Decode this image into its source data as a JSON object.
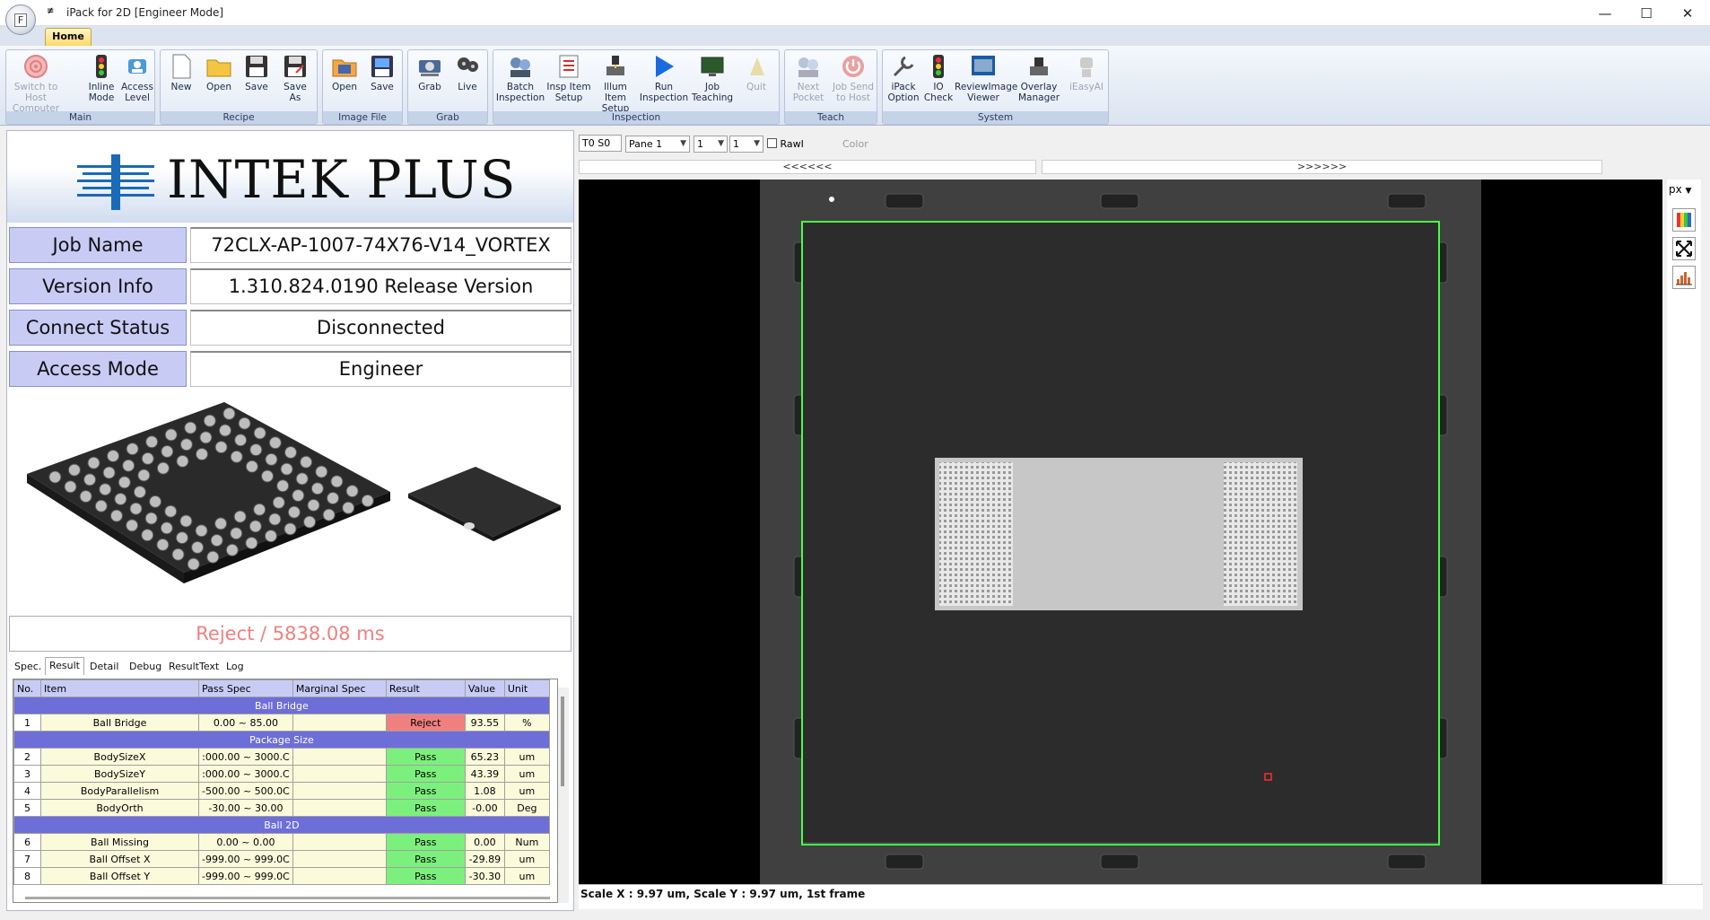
{
  "window": {
    "title": "iPack for 2D [Engineer Mode]",
    "orb_label": "F",
    "qat_glyph": "≢"
  },
  "ribbon": {
    "tab_home": "Home",
    "groups": [
      {
        "label": "Main",
        "buttons": [
          "Switch to Host Computer",
          "Inline Mode",
          "Access Level"
        ]
      },
      {
        "label": "Recipe",
        "buttons": [
          "New",
          "Open",
          "Save",
          "Save As"
        ]
      },
      {
        "label": "Image File",
        "buttons": [
          "Open",
          "Save"
        ]
      },
      {
        "label": "Grab",
        "buttons": [
          "Grab",
          "Live"
        ]
      },
      {
        "label": "Inspection",
        "buttons": [
          "Batch Inspection",
          "Insp Item Setup",
          "Illum Item Setup",
          "Run Inspection",
          "Job Teaching",
          "Quit"
        ]
      },
      {
        "label": "Teach",
        "buttons": [
          "Next Pocket",
          "Job Send to Host"
        ]
      },
      {
        "label": "System",
        "buttons": [
          "iPack Option",
          "IO Check",
          "ReviewImage Viewer",
          "Overlay Manager",
          "iEasyAI"
        ]
      }
    ]
  },
  "logo": {
    "text": "INTEK PLUS"
  },
  "info": {
    "job_name_label": "Job Name",
    "job_name": "72CLX-AP-1007-74X76-V14_VORTEX",
    "version_label": "Version Info",
    "version": "1.310.824.0190 Release Version",
    "connect_label": "Connect Status",
    "connect": "Disconnected",
    "access_label": "Access Mode",
    "access": "Engineer"
  },
  "result_summary": "Reject / 5838.08 ms",
  "subtabs": [
    "Spec.",
    "Result",
    "Detail",
    "Debug",
    "ResultText",
    "Log"
  ],
  "grid": {
    "headers": [
      "No.",
      "Item",
      "Pass Spec",
      "Marginal Spec",
      "Result",
      "Value",
      "Unit"
    ],
    "groups": {
      "bridge": "Ball Bridge",
      "package": "Package Size",
      "ball2d": "Ball 2D"
    },
    "rows": [
      [
        "1",
        "Ball Bridge",
        "0.00 ~ 85.00",
        "",
        "Reject",
        "93.55",
        "%"
      ],
      [
        "2",
        "BodySizeX",
        ":000.00 ~ 3000.C",
        "",
        "Pass",
        "65.23",
        "um"
      ],
      [
        "3",
        "BodySizeY",
        ":000.00 ~ 3000.C",
        "",
        "Pass",
        "43.39",
        "um"
      ],
      [
        "4",
        "BodyParallelism",
        "-500.00 ~ 500.0C",
        "",
        "Pass",
        "1.08",
        "um"
      ],
      [
        "5",
        "BodyOrth",
        "-30.00 ~ 30.00",
        "",
        "Pass",
        "-0.00",
        "Deg"
      ],
      [
        "6",
        "Ball Missing",
        "0.00 ~ 0.00",
        "",
        "Pass",
        "0.00",
        "Num"
      ],
      [
        "7",
        "Ball Offset X",
        "-999.00 ~ 999.0C",
        "",
        "Pass",
        "-29.89",
        "um"
      ],
      [
        "8",
        "Ball Offset Y",
        "-999.00 ~ 999.0C",
        "",
        "Pass",
        "-30.30",
        "um"
      ]
    ]
  },
  "viewer": {
    "station": "T0 S0",
    "pane": "Pane 1",
    "sel1": "1",
    "sel2": "1",
    "raw_label": "RawI",
    "color_label": "Color",
    "nav_prev": "<<<<<<",
    "nav_next": ">>>>>>",
    "unit": "px",
    "status": "Scale X : 9.97 um, Scale Y : 9.97 um, 1st frame"
  },
  "colors": {
    "reject": "#f08080",
    "pass": "#7cf07c",
    "header": "#c8ccf5",
    "group_row": "#6e6ed8",
    "roi": "#44ff44"
  }
}
